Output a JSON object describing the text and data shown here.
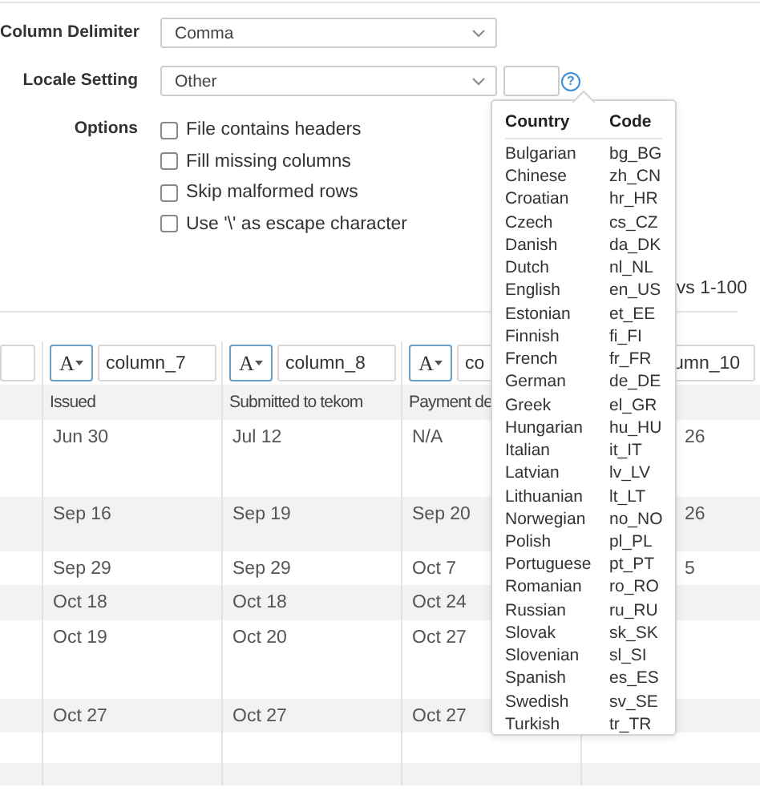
{
  "form": {
    "column_delimiter": {
      "label": "Column Delimiter",
      "value": "Comma"
    },
    "locale_setting": {
      "label": "Locale Setting",
      "value": "Other",
      "help": "?"
    },
    "options": {
      "label": "Options",
      "items": [
        {
          "label": "File contains headers",
          "checked": false
        },
        {
          "label": "Fill missing columns",
          "checked": false
        },
        {
          "label": "Skip malformed rows",
          "checked": false
        },
        {
          "label": "Use '\\' as escape character",
          "checked": false
        }
      ]
    }
  },
  "rows_info": "vs 1-100",
  "table": {
    "columns": [
      {
        "type_icon": "A",
        "name": "column_7",
        "header": "Issued"
      },
      {
        "type_icon": "A",
        "name": "column_8",
        "header": "Submitted to tekom"
      },
      {
        "type_icon": "A",
        "name": "co",
        "header": "Payment de"
      },
      {
        "name": "umn_10"
      }
    ],
    "rows": [
      {
        "cells": [
          "Jun 30",
          "Jul 12",
          "N/A",
          "26"
        ]
      },
      {
        "cells": [
          "Sep 16",
          "Sep 19",
          "Sep 20",
          "26"
        ]
      },
      {
        "cells": [
          "Sep 29",
          "Sep 29",
          "Oct 7",
          "5"
        ]
      },
      {
        "cells": [
          "Oct 18",
          "Oct 18",
          "Oct 24"
        ]
      },
      {
        "cells": [
          "Oct 19",
          "Oct 20",
          "Oct 27"
        ]
      },
      {
        "cells": [
          "Oct 27",
          "Oct 27",
          "Oct 27"
        ]
      }
    ]
  },
  "locale_popover": {
    "columns": [
      "Country",
      "Code"
    ],
    "rows": [
      [
        "Bulgarian",
        "bg_BG"
      ],
      [
        "Chinese",
        "zh_CN"
      ],
      [
        "Croatian",
        "hr_HR"
      ],
      [
        "Czech",
        "cs_CZ"
      ],
      [
        "Danish",
        "da_DK"
      ],
      [
        "Dutch",
        "nl_NL"
      ],
      [
        "English",
        "en_US"
      ],
      [
        "Estonian",
        "et_EE"
      ],
      [
        "Finnish",
        "fi_FI"
      ],
      [
        "French",
        "fr_FR"
      ],
      [
        "German",
        "de_DE"
      ],
      [
        "Greek",
        "el_GR"
      ],
      [
        "Hungarian",
        "hu_HU"
      ],
      [
        "Italian",
        "it_IT"
      ],
      [
        "Latvian",
        "lv_LV"
      ],
      [
        "Lithuanian",
        "lt_LT"
      ],
      [
        "Norwegian",
        "no_NO"
      ],
      [
        "Polish",
        "pl_PL"
      ],
      [
        "Portuguese",
        "pt_PT"
      ],
      [
        "Romanian",
        "ro_RO"
      ],
      [
        "Russian",
        "ru_RU"
      ],
      [
        "Slovak",
        "sk_SK"
      ],
      [
        "Slovenian",
        "sl_SI"
      ],
      [
        "Spanish",
        "es_ES"
      ],
      [
        "Swedish",
        "sv_SE"
      ],
      [
        "Turkish",
        "tr_TR"
      ]
    ]
  }
}
